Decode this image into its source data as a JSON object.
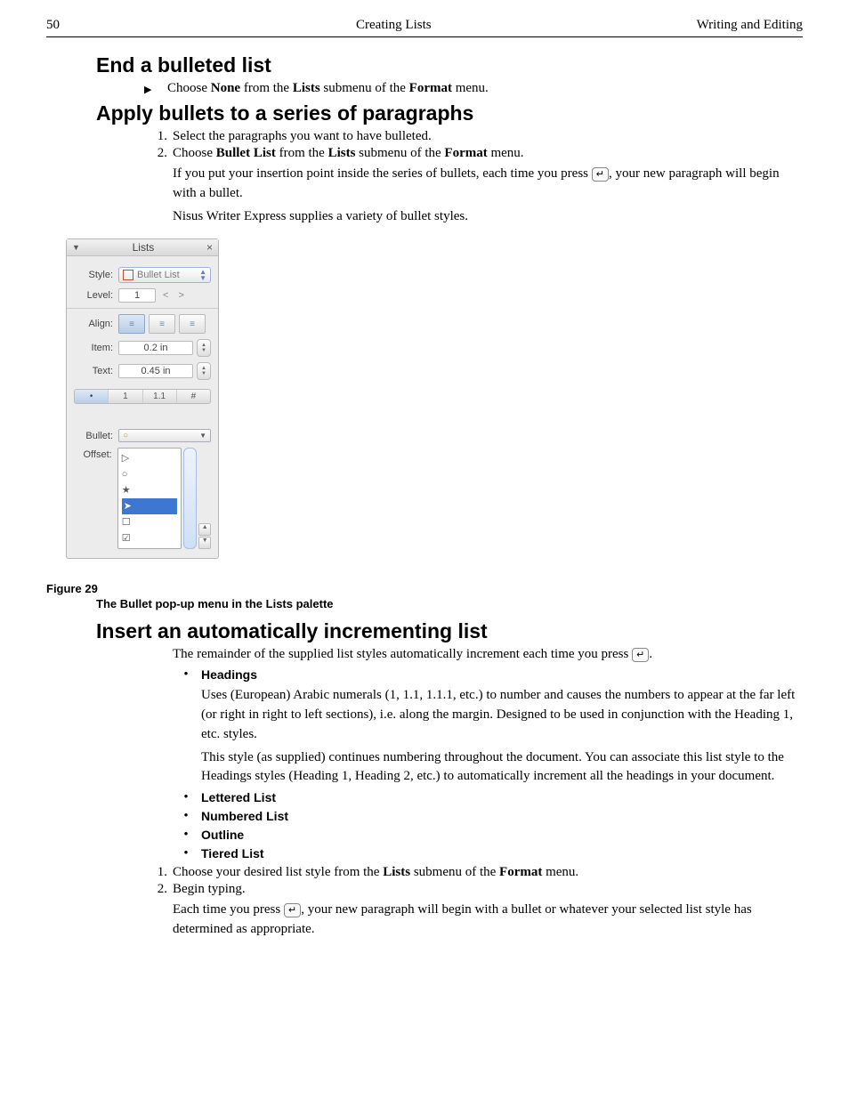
{
  "header": {
    "page": "50",
    "center": "Creating Lists",
    "right": "Writing and Editing"
  },
  "sec1": {
    "title": "End a bulleted list",
    "step_pre": "Choose ",
    "step_b1": "None",
    "step_mid": " from the ",
    "step_b2": "Lists",
    "step_mid2": " submenu of the ",
    "step_b3": "Format",
    "step_end": " menu."
  },
  "sec2": {
    "title": "Apply bullets to a series of paragraphs",
    "n1": "1.",
    "s1": "Select the paragraphs you want to have bulleted.",
    "n2": "2.",
    "s2_pre": "Choose ",
    "s2_b1": "Bullet List",
    "s2_mid": " from the ",
    "s2_b2": "Lists",
    "s2_mid2": " submenu of the ",
    "s2_b3": "Format",
    "s2_end": " menu.",
    "p1a": "If you put your insertion point inside the series of bullets, each time you press ",
    "key": "↵",
    "p1b": ", your new paragraph will begin with a bullet.",
    "p2": "Nisus Writer Express supplies a variety of bullet styles."
  },
  "palette": {
    "title": "Lists",
    "style_lbl": "Style:",
    "style_val": "Bullet List",
    "level_lbl": "Level:",
    "level_val": "1",
    "level_arrows": "<  >",
    "align_lbl": "Align:",
    "item_lbl": "Item:",
    "item_val": "0.2 in",
    "text_lbl": "Text:",
    "text_val": "0.45 in",
    "tab_bullet": "•",
    "tab_1": "1",
    "tab_11": "1.1",
    "tab_hash": "#",
    "bullet_lbl": "Bullet:",
    "bullet_val": "○",
    "offset_lbl": "Offset:",
    "opts": [
      "▷",
      "○",
      "★",
      "➤",
      "☐",
      "☑"
    ],
    "sel_idx": 3
  },
  "figure": {
    "label": "Figure 29",
    "caption": "The Bullet pop-up menu in the Lists palette"
  },
  "sec3": {
    "title": "Insert an automatically incrementing list",
    "intro_a": "The remainder of the supplied list styles automatically increment each time you press ",
    "intro_b": ".",
    "h_headings": "Headings",
    "p_headings1": "Uses (European) Arabic numerals (1, 1.1, 1.1.1, etc.) to number and causes the numbers to appear at the far left (or right in right to left sections), i.e. along the margin. Designed to be used in conjunction with the Heading 1, etc. styles.",
    "p_headings2": "This style (as supplied) continues numbering throughout the document. You can associate this list style to the Headings styles (Heading 1, Heading 2, etc.) to automatically increment all the headings in your document.",
    "b_lettered": "Lettered List",
    "b_numbered": "Numbered List",
    "b_outline": "Outline",
    "b_tiered": "Tiered List",
    "n1": "1.",
    "s1_a": "Choose your desired list style from the ",
    "s1_b1": "Lists",
    "s1_mid": " submenu of the ",
    "s1_b2": "Format",
    "s1_end": " menu.",
    "n2": "2.",
    "s2": "Begin typing.",
    "p_last_a": "Each time you press ",
    "p_last_b": ", your new paragraph will begin with a bullet or whatever your selected list style has determined as appropriate."
  }
}
